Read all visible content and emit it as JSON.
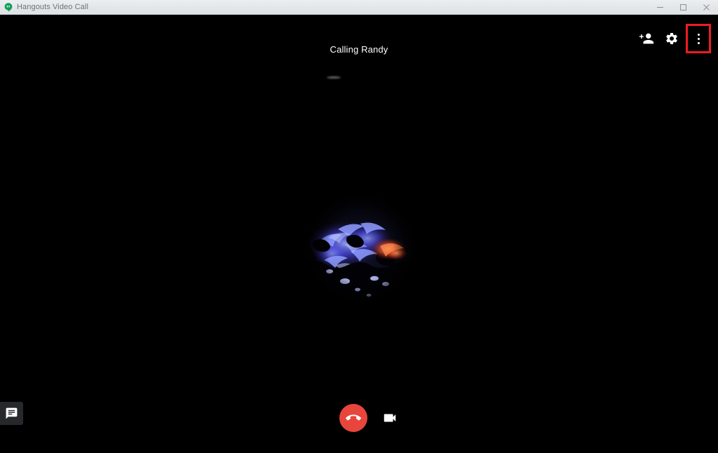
{
  "window": {
    "title": "Hangouts Video Call",
    "app_icon": "hangouts-icon",
    "controls": {
      "minimize_label": "Minimize",
      "maximize_label": "Maximize",
      "close_label": "Close"
    }
  },
  "call": {
    "status_text": "Calling Randy",
    "contact_name": "Randy",
    "avatar_alt": "Randy avatar",
    "background_color": "#000000"
  },
  "top_actions": [
    {
      "name": "add-person-button",
      "label": "Add people",
      "icon": "person-add-icon"
    },
    {
      "name": "settings-button",
      "label": "Settings",
      "icon": "gear-icon"
    },
    {
      "name": "overflow-menu-button",
      "label": "More options",
      "icon": "more-vert-icon",
      "highlighted": true,
      "highlight_color": "#ee1c25"
    }
  ],
  "call_controls": [
    {
      "name": "end-call-button",
      "label": "End call",
      "icon": "call-end-icon",
      "color": "#e8453c"
    },
    {
      "name": "camera-toggle-button",
      "label": "Turn off camera",
      "icon": "videocam-icon",
      "color": "#ffffff"
    }
  ],
  "chat": {
    "button_label": "Chat",
    "icon": "chat-bubble-icon"
  }
}
